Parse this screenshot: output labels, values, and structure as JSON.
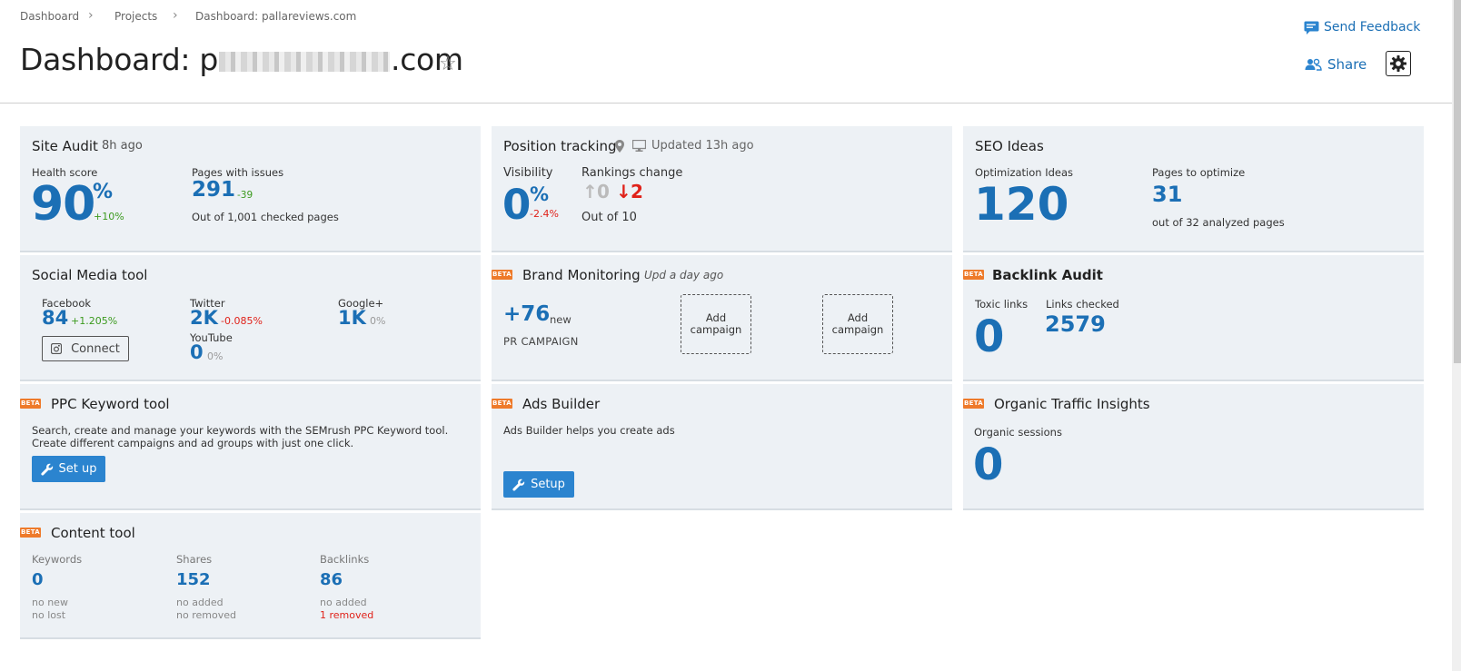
{
  "breadcrumbs": [
    "Dashboard",
    "Projects",
    "Dashboard: pallareviews.com"
  ],
  "header": {
    "title_prefix": "Dashboard: p",
    "title_suffix": ".com",
    "send_feedback": "Send Feedback",
    "share": "Share"
  },
  "site_audit": {
    "title": "Site Audit",
    "updated": "8h ago",
    "health_label": "Health score",
    "health_value": "90",
    "health_unit": "%",
    "health_delta": "+10%",
    "pages_label": "Pages with issues",
    "pages_value": "291",
    "pages_delta": "-39",
    "pages_note": "Out of 1,001 checked pages"
  },
  "position_tracking": {
    "title": "Position tracking",
    "updated": "Updated 13h ago",
    "visibility_label": "Visibility",
    "visibility_value": "0",
    "visibility_unit": "%",
    "visibility_delta": "-2.4%",
    "rankings_label": "Rankings change",
    "up_value": "0",
    "down_value": "2",
    "out_of": "Out of 10"
  },
  "seo_ideas": {
    "title": "SEO Ideas",
    "ideas_label": "Optimization Ideas",
    "ideas_value": "120",
    "pages_label": "Pages to optimize",
    "pages_value": "31",
    "pages_note": "out of 32 analyzed pages"
  },
  "social_media": {
    "title": "Social Media tool",
    "facebook_label": "Facebook",
    "facebook_value": "84",
    "facebook_delta": "+1.205%",
    "twitter_label": "Twitter",
    "twitter_value": "2K",
    "twitter_delta": "-0.085%",
    "google_label": "Google+",
    "google_value": "1K",
    "google_delta": "0%",
    "youtube_label": "YouTube",
    "youtube_value": "0",
    "youtube_delta": "0%",
    "connect_label": "Connect"
  },
  "brand_monitoring": {
    "badge": "BETA",
    "title": "Brand Monitoring",
    "updated": "Upd a day ago",
    "value": "+76",
    "value_suffix": "new",
    "campaign_label": "PR CAMPAIGN",
    "add_line1": "Add",
    "add_line2": "campaign"
  },
  "backlink_audit": {
    "badge": "BETA",
    "title": "Backlink Audit",
    "toxic_label": "Toxic links",
    "toxic_value": "0",
    "checked_label": "Links checked",
    "checked_value": "2579"
  },
  "ppc": {
    "badge": "BETA",
    "title": "PPC Keyword tool",
    "desc_line1": "Search, create and manage your keywords with the SEMrush PPC Keyword tool.",
    "desc_line2": "Create different campaigns and ad groups with just one click.",
    "button": "Set up"
  },
  "ads_builder": {
    "badge": "BETA",
    "title": "Ads Builder",
    "desc": "Ads Builder helps you create ads",
    "button": "Setup"
  },
  "organic": {
    "badge": "BETA",
    "title": "Organic Traffic Insights",
    "sessions_label": "Organic sessions",
    "sessions_value": "0"
  },
  "content_tool": {
    "badge": "BETA",
    "title": "Content tool",
    "keywords_label": "Keywords",
    "keywords_value": "0",
    "keywords_note1": "no new",
    "keywords_note2": "no lost",
    "shares_label": "Shares",
    "shares_value": "152",
    "shares_note1": "no added",
    "shares_note2": "no removed",
    "backlinks_label": "Backlinks",
    "backlinks_value": "86",
    "backlinks_note1": "no added",
    "backlinks_note2": "1 removed"
  },
  "colors": {
    "accent": "#1b6fb5",
    "button": "#2b84cf",
    "beta": "#ee7a2a",
    "positive": "#3b9a1e",
    "negative": "#e0221a",
    "widget_bg": "#edf1f5"
  },
  "icons": [
    "chevron-right-icon",
    "star-icon",
    "feedback-icon",
    "share-users-icon",
    "gear-icon",
    "location-pin-icon",
    "monitor-icon",
    "camera-icon",
    "wrench-icon",
    "arrow-up-icon",
    "arrow-down-icon"
  ]
}
